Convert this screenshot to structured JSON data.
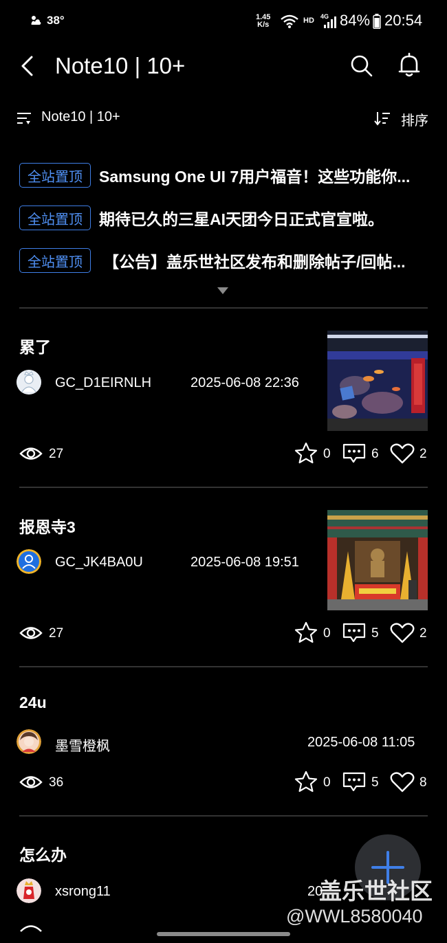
{
  "status_bar": {
    "temperature": "38°",
    "net_speed_value": "1.45",
    "net_speed_unit": "K/s",
    "hd": "HD",
    "network": "4G",
    "battery": "84%",
    "time": "20:54"
  },
  "header": {
    "title": "Note10 | 10+",
    "back_icon": "back-arrow-icon",
    "search_icon": "search-icon",
    "bell_icon": "bell-icon"
  },
  "filter_bar": {
    "filter_label": "Note10 | 10+",
    "sort_label": "排序"
  },
  "pinned": [
    {
      "badge": "全站置顶",
      "text": "Samsung One UI 7用户福音！这些功能你..."
    },
    {
      "badge": "全站置顶",
      "text": "期待已久的三星AI天团今日正式官宣啦。"
    },
    {
      "badge": "全站置顶",
      "text": "【公告】盖乐世社区发布和删除帖子/回帖..."
    }
  ],
  "posts": [
    {
      "title": "累了",
      "author": "GC_D1EIRNLH",
      "time": "2025-06-08 22:36",
      "views": "27",
      "favorites": "0",
      "comments": "6",
      "likes": "2"
    },
    {
      "title": "报恩寺3",
      "author": "GC_JK4BA0U",
      "time": "2025-06-08 19:51",
      "views": "27",
      "favorites": "0",
      "comments": "5",
      "likes": "2"
    },
    {
      "title": "24u",
      "author": "墨雪橙枫",
      "time": "2025-06-08 11:05",
      "views": "36",
      "favorites": "0",
      "comments": "5",
      "likes": "8"
    },
    {
      "title": "怎么办",
      "author": "xsrong11",
      "time": "20"
    }
  ],
  "watermark": {
    "line1": "盖乐世社区",
    "line2": "@WWL8580040"
  },
  "colors": {
    "accent": "#3f7fe8",
    "background": "#000000",
    "divider": "#333333"
  }
}
